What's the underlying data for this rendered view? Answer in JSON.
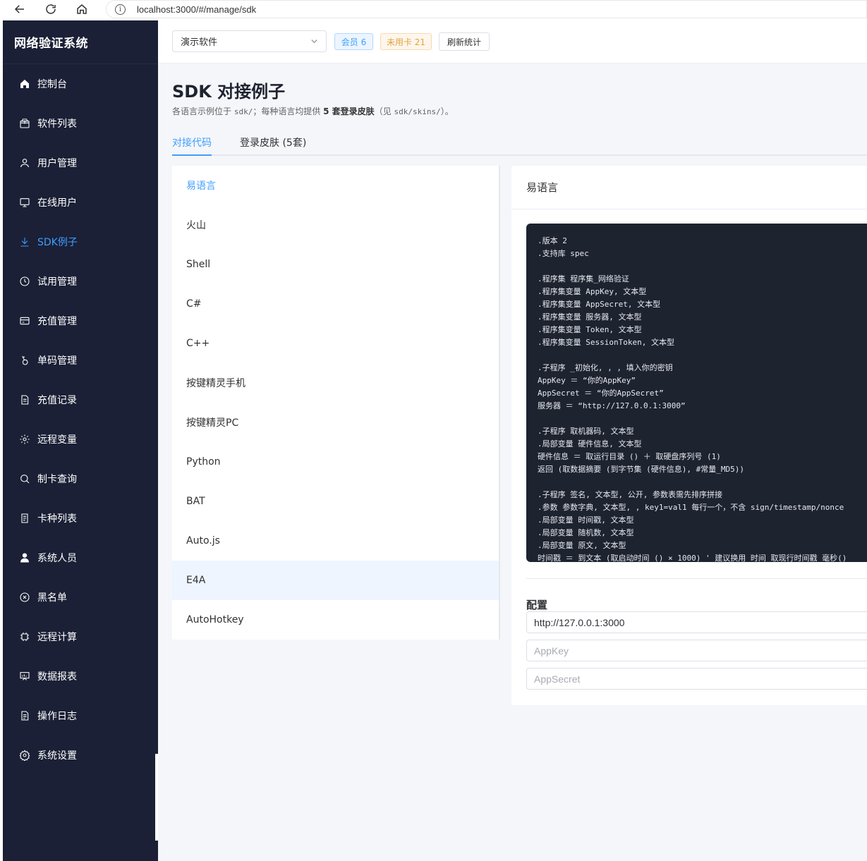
{
  "browser": {
    "url": "localhost:3000/#/manage/sdk"
  },
  "sidebar": {
    "brand": "网络验证系统",
    "items": [
      {
        "label": "控制台",
        "icon": "home-icon"
      },
      {
        "label": "软件列表",
        "icon": "package-icon"
      },
      {
        "label": "用户管理",
        "icon": "user-icon"
      },
      {
        "label": "在线用户",
        "icon": "monitor-icon"
      },
      {
        "label": "SDK例子",
        "icon": "download-icon",
        "active": true
      },
      {
        "label": "试用管理",
        "icon": "clock-icon"
      },
      {
        "label": "充值管理",
        "icon": "card-icon"
      },
      {
        "label": "单码管理",
        "icon": "key-icon"
      },
      {
        "label": "充值记录",
        "icon": "document-icon"
      },
      {
        "label": "远程变量",
        "icon": "gear-icon"
      },
      {
        "label": "制卡查询",
        "icon": "search-icon"
      },
      {
        "label": "卡种列表",
        "icon": "list-document-icon"
      },
      {
        "label": "系统人员",
        "icon": "person-icon"
      },
      {
        "label": "黑名单",
        "icon": "circle-x-icon"
      },
      {
        "label": "远程计算",
        "icon": "chip-icon"
      },
      {
        "label": "数据报表",
        "icon": "chart-board-icon"
      },
      {
        "label": "操作日志",
        "icon": "log-document-icon"
      },
      {
        "label": "系统设置",
        "icon": "settings-icon"
      }
    ]
  },
  "topbar": {
    "software_select": "演示软件",
    "member_tag": "会员 6",
    "unused_tag": "未用卡 21",
    "refresh_label": "刷新统计"
  },
  "page": {
    "title": "SDK 对接例子",
    "desc_prefix": "各语言示例位于 ",
    "desc_path1": "sdk/",
    "desc_mid": "；每种语言均提供 ",
    "desc_bold": "5 套登录皮肤",
    "desc_paren_open": "（见 ",
    "desc_path2": "sdk/skins/",
    "desc_paren_close": "）。",
    "tabs": [
      "对接代码",
      "登录皮肤 (5套)"
    ]
  },
  "languages": [
    "易语言",
    "火山",
    "Shell",
    "C#",
    "C++",
    "按键精灵手机",
    "按键精灵PC",
    "Python",
    "BAT",
    "Auto.js",
    "E4A",
    "AutoHotkey"
  ],
  "panel": {
    "title": "易语言",
    "code_lines": [
      ".版本 2",
      ".支持库 spec",
      "",
      ".程序集 程序集_网络验证",
      ".程序集变量 AppKey, 文本型",
      ".程序集变量 AppSecret, 文本型",
      ".程序集变量 服务器, 文本型",
      ".程序集变量 Token, 文本型",
      ".程序集变量 SessionToken, 文本型",
      "",
      ".子程序 _初始化, , , 填入你的密钥",
      "AppKey ＝ “你的AppKey”",
      "AppSecret ＝ “你的AppSecret”",
      "服务器 ＝ “http://127.0.0.1:3000”",
      "",
      ".子程序 取机器码, 文本型",
      ".局部变量 硬件信息, 文本型",
      "硬件信息 ＝ 取运行目录 () ＋ 取硬盘序列号 (1)",
      "返回 (取数据摘要 (到字节集 (硬件信息), #常量_MD5))",
      "",
      ".子程序 签名, 文本型, 公开, 参数表需先排序拼接",
      ".参数 参数字典, 文本型, , key1=val1 每行一个，不含 sign/timestamp/nonce",
      ".局部变量 时间戳, 文本型",
      ".局部变量 随机数, 文本型",
      ".局部变量 原文, 文本型",
      "时间戳 ＝ 到文本 (取启动时间 () × 1000) ' 建议换用 时间_取现行时间戳 毫秒()"
    ],
    "config_title": "配置",
    "server_value": "http://127.0.0.1:3000",
    "appkey_placeholder": "AppKey",
    "appsecret_placeholder": "AppSecret"
  }
}
